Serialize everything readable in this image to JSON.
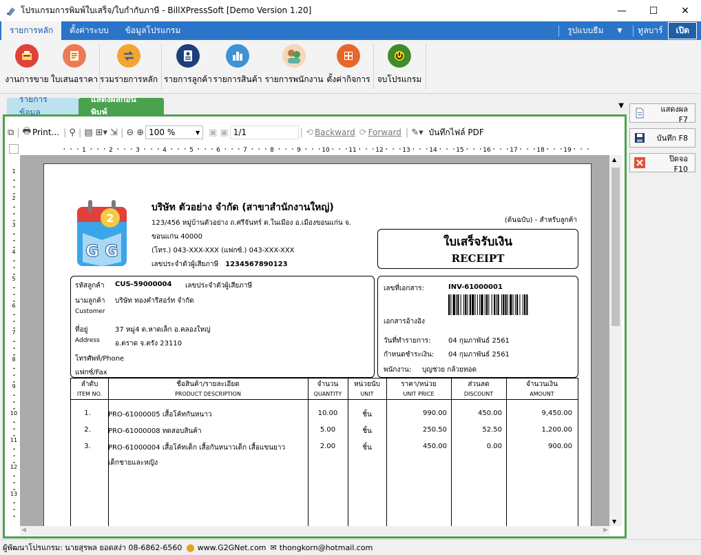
{
  "window": {
    "title": "โปรแกรมการพิมพ์ใบเสร็จ/ใบกำกับภาษี - BillXPressSoft [Demo Version 1.20]",
    "minimize": "—",
    "maximize": "☐",
    "close": "✕"
  },
  "ribbon_tabs": {
    "items": [
      "รายการหลัก",
      "ตั้งค่าระบบ",
      "ข้อมูลโปรแกรม"
    ],
    "skin_label": "รูปแบบธีม",
    "toolbar_label": "ทูลบาร์",
    "toggle_label": "เปิด"
  },
  "ribbon_buttons": [
    {
      "label": "งานการขาย",
      "icon": "sales-icon",
      "color": "#e0423a"
    },
    {
      "label": "ใบเสนอราคา",
      "icon": "quotation-icon",
      "color": "#ee7a55"
    },
    {
      "label": "รวมรายการหลัก",
      "icon": "consolidate-icon",
      "color": "#f2a531"
    },
    {
      "label": "รายการลูกค้า",
      "icon": "customer-list-icon",
      "color": "#1d3f7a"
    },
    {
      "label": "รายการสินค้า",
      "icon": "product-list-icon",
      "color": "#3e92d6"
    },
    {
      "label": "รายการพนักงาน",
      "icon": "employee-list-icon",
      "color": "#5fb0a0"
    },
    {
      "label": "ตั้งค่ากิจการ",
      "icon": "business-settings-icon",
      "color": "#e8662b"
    },
    {
      "label": "จบโปรแกรม",
      "icon": "exit-icon",
      "color": "#3e8c2b"
    }
  ],
  "doc_tabs": {
    "tab1": "รายการข้อมูล",
    "tab2": "แสดงผลก่อนพิมพ์"
  },
  "preview_toolbar": {
    "print_label": "Print...",
    "zoom_value": "100 %",
    "page_value": "1/1",
    "backward_label": "Backward",
    "forward_label": "Forward",
    "save_pdf_label": "บันทึกไฟล์ PDF"
  },
  "ruler": {
    "h_numbers": [
      "1",
      "2",
      "3",
      "4",
      "5",
      "6",
      "7",
      "8",
      "9",
      "10",
      "11",
      "12",
      "13",
      "14",
      "15",
      "16",
      "17",
      "18",
      "19"
    ],
    "v_numbers": [
      "1",
      "2",
      "3",
      "4",
      "5",
      "6",
      "7",
      "8",
      "9",
      "10",
      "11",
      "12",
      "13"
    ]
  },
  "invoice": {
    "company_name": "บริษัท ตัวอย่าง จำกัด (สาขาสำนักงานใหญ่)",
    "address_line1": "123/456 หมู่บ้านตัวอย่าง ถ.ศรีจันทร์ ต.ในเมือง อ.เมืองขอนแก่น จ.",
    "address_line2": "ขอนแก่น 40000",
    "phone_line": "(โทร.) 043-XXX-XXX (แฟกซ์.) 043-XXX-XXX",
    "tax_label": "เลขประจำตัวผู้เสียภาษี",
    "tax_value": "1234567890123",
    "copy_label": "(ต้นฉบับ) - สำหรับลูกค้า",
    "doc_title_th": "ใบเสร็จรับเงิน",
    "doc_title_en": "RECEIPT",
    "logo_number": "2",
    "logo_letters": "G G",
    "customer": {
      "code_label": "รหัสลูกค้า",
      "code_value": "CUS-59000004",
      "tax_label": "เลขประจำตัวผู้เสียภาษี",
      "name_label": "นามลูกค้า",
      "name_en_label": "Customer",
      "name_value": "บริษัท ทองคำรีสอร์ท จำกัด",
      "address_label": "ที่อยู่",
      "address_en_label": "Address",
      "address_line1": "37 หมู่4 ต.หาดเล็ก อ.คลองใหญ่",
      "address_line2": "อ.ตราด จ.ตรัง 23110",
      "phone_label": "โทรศัพท์/Phone",
      "fax_label": "แฟกซ์/Fax"
    },
    "document": {
      "doc_no_label": "เลขที่เอกสาร:",
      "doc_no_value": "INV-61000001",
      "ref_label": "เอกสารอ้างอิง",
      "date_label": "วันที่ทำรายการ:",
      "date_value": "04 กุมภาพันธ์ 2561",
      "due_label": "กำหนดชำระเงิน:",
      "due_value": "04 กุมภาพันธ์ 2561",
      "staff_label": "พนักงาน:",
      "staff_value": "บุญช่วย กล้วยทอด"
    },
    "columns": [
      {
        "th": "ลำดับ",
        "en": "ITEM NO."
      },
      {
        "th": "ชื่อสินค้า/รายละเอียด",
        "en": "PRODUCT DESCRIPTION"
      },
      {
        "th": "จำนวน",
        "en": "QUANTITY"
      },
      {
        "th": "หน่วยนับ",
        "en": "UNIT"
      },
      {
        "th": "ราคา/หน่วย",
        "en": "UNIT PRICE"
      },
      {
        "th": "ส่วนลด",
        "en": "DISCOUNT"
      },
      {
        "th": "จำนวนเงิน",
        "en": "AMOUNT"
      }
    ],
    "items": [
      {
        "no": "1.",
        "desc": "PRO-61000005 เสื้อโค้ทกันหนาว",
        "desc2": "",
        "qty": "10.00",
        "unit": "ชิ้น",
        "price": "990.00",
        "discount": "450.00",
        "amount": "9,450.00"
      },
      {
        "no": "2.",
        "desc": "PRO-61000008 ทดสอบสินค้า",
        "desc2": "",
        "qty": "5.00",
        "unit": "ชิ้น",
        "price": "250.50",
        "discount": "52.50",
        "amount": "1,200.00"
      },
      {
        "no": "3.",
        "desc": "PRO-61000004 เสื้อโค้ทเด็ก เสื้อกันหนาวเด็ก เสื้อแขนยาว",
        "desc2": "เด็กชายและหญิง",
        "qty": "2.00",
        "unit": "ชิ้น",
        "price": "450.00",
        "discount": "0.00",
        "amount": "900.00"
      }
    ]
  },
  "side_buttons": {
    "show": "แสดงผล F7",
    "save": "บันทึก F8",
    "close": "ปิดจอ F10"
  },
  "statusbar": {
    "developer": "ผู้พัฒนาโปรแกรม: นายสุรพล ยอดสง่า 08-6862-6560",
    "website": "www.G2GNet.com",
    "email": "thongkorn@hotmail.com"
  },
  "colors": {
    "ribbon_blue": "#2b75c9",
    "preview_green": "#4aa14e",
    "list_tab_blue": "#bde1ee"
  }
}
